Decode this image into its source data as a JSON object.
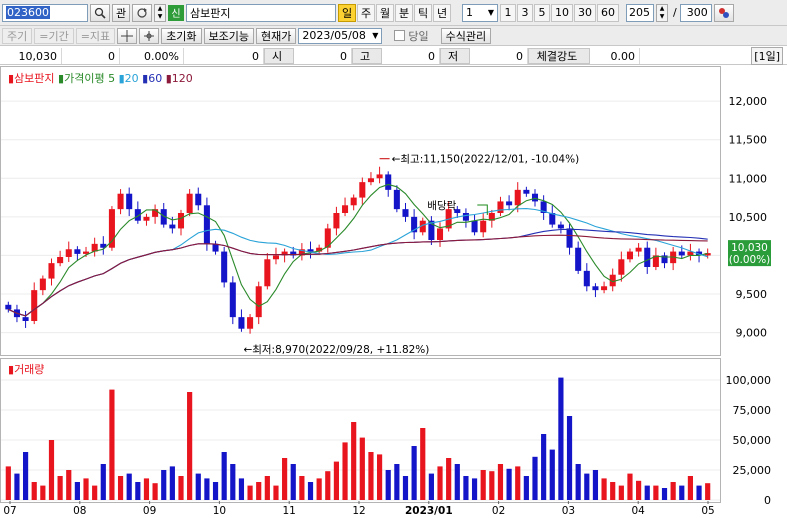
{
  "toolbar": {
    "code_value": "023600",
    "search_icon": "search-icon",
    "rel_label": "관",
    "badge_new": "신",
    "name_value": "삼보판지",
    "badge_il": "일",
    "periods": [
      "주",
      "월",
      "분",
      "틱",
      "년"
    ],
    "interval_value": "1",
    "intervals": [
      "1",
      "3",
      "5",
      "10",
      "30",
      "60"
    ],
    "count_value": "205",
    "slash": "/",
    "total_value": "300"
  },
  "toolbar2": {
    "dis1": "주기",
    "dis2": "=기간",
    "dis3": "=지표",
    "reset_label": "초기화",
    "aux_label": "보조기능",
    "curprice_label": "현재가",
    "date_value": "2023/05/08",
    "today_label": "당일",
    "formula_label": "수식관리"
  },
  "quote": {
    "price": "10,030",
    "change": "0",
    "rate": "0.00%",
    "volume": "0",
    "open_label": "시",
    "open": "0",
    "high_label": "고",
    "high": "0",
    "low_label": "저",
    "low": "0",
    "strength_label": "체결강도",
    "strength": "0.00",
    "period_tag": "[1일]"
  },
  "legend": {
    "name": "삼보판지",
    "disparity": "가격이평",
    "ma5": "5",
    "ma20": "20",
    "ma60": "60",
    "ma120": "120",
    "volume": "거래량"
  },
  "colors": {
    "up": "#e8141e",
    "down": "#1414c8",
    "ma5": "#2a8a2a",
    "ma20": "#2aa3d8",
    "ma60": "#2430b4",
    "ma120": "#8c1a3a",
    "annotation": "#c80000"
  },
  "annotations": {
    "high": "최고:11,150(2022/12/01, -10.04%)",
    "low": "최저:8,970(2022/09/28, +11.82%)",
    "dividend": "배당락",
    "price_tag": "10,030",
    "rate_tag": "(0.00%)"
  },
  "chart_data": [
    {
      "type": "candlestick",
      "price_axis_labels": [
        "12,000",
        "11,500",
        "11,000",
        "10,500",
        "10,000",
        "9,500",
        "9,000"
      ],
      "ylim": [
        8800,
        12300
      ],
      "x_labels": [
        "07",
        "08",
        "09",
        "10",
        "11",
        "12",
        "2023/01",
        "02",
        "03",
        "04",
        "05"
      ],
      "close_series": [
        9300,
        9200,
        9150,
        9550,
        9700,
        9900,
        9980,
        10080,
        10020,
        10050,
        10150,
        10100,
        10600,
        10800,
        10600,
        10450,
        10500,
        10600,
        10400,
        10350,
        10550,
        10800,
        10650,
        10150,
        10050,
        9650,
        9200,
        9050,
        9200,
        9600,
        9950,
        10000,
        10050,
        10000,
        10080,
        10050,
        10100,
        10350,
        10550,
        10650,
        10750,
        10950,
        11000,
        11050,
        10850,
        10600,
        10500,
        10300,
        10450,
        10200,
        10350,
        10600,
        10550,
        10450,
        10300,
        10450,
        10550,
        10700,
        10650,
        10850,
        10800,
        10700,
        10550,
        10400,
        10350,
        10100,
        9800,
        9600,
        9550,
        9600,
        9750,
        9950,
        10050,
        10100,
        9850,
        10000,
        9900,
        10050,
        10000,
        10050,
        10000,
        10030
      ],
      "high": 11150,
      "low": 8970,
      "last": 10030
    },
    {
      "type": "bar",
      "title": "거래량",
      "axis_labels": [
        "100,000",
        "75,000",
        "50,000",
        "25,000",
        "0"
      ],
      "ylim": [
        0,
        110000
      ],
      "values": [
        28000,
        22000,
        40000,
        15000,
        12000,
        50000,
        20000,
        25000,
        15000,
        18000,
        12000,
        30000,
        92000,
        20000,
        22000,
        15000,
        18000,
        14000,
        25000,
        28000,
        20000,
        90000,
        22000,
        18000,
        15000,
        40000,
        30000,
        18000,
        12000,
        15000,
        20000,
        12000,
        35000,
        30000,
        20000,
        15000,
        18000,
        24000,
        32000,
        48000,
        65000,
        52000,
        40000,
        38000,
        25000,
        30000,
        20000,
        45000,
        60000,
        22000,
        28000,
        35000,
        30000,
        20000,
        18000,
        25000,
        24000,
        30000,
        26000,
        28000,
        20000,
        36000,
        55000,
        42000,
        102000,
        70000,
        30000,
        22000,
        25000,
        18000,
        15000,
        12000,
        22000,
        16000,
        12000,
        12000,
        10000,
        15000,
        12000,
        20000,
        12000,
        14000
      ]
    }
  ]
}
